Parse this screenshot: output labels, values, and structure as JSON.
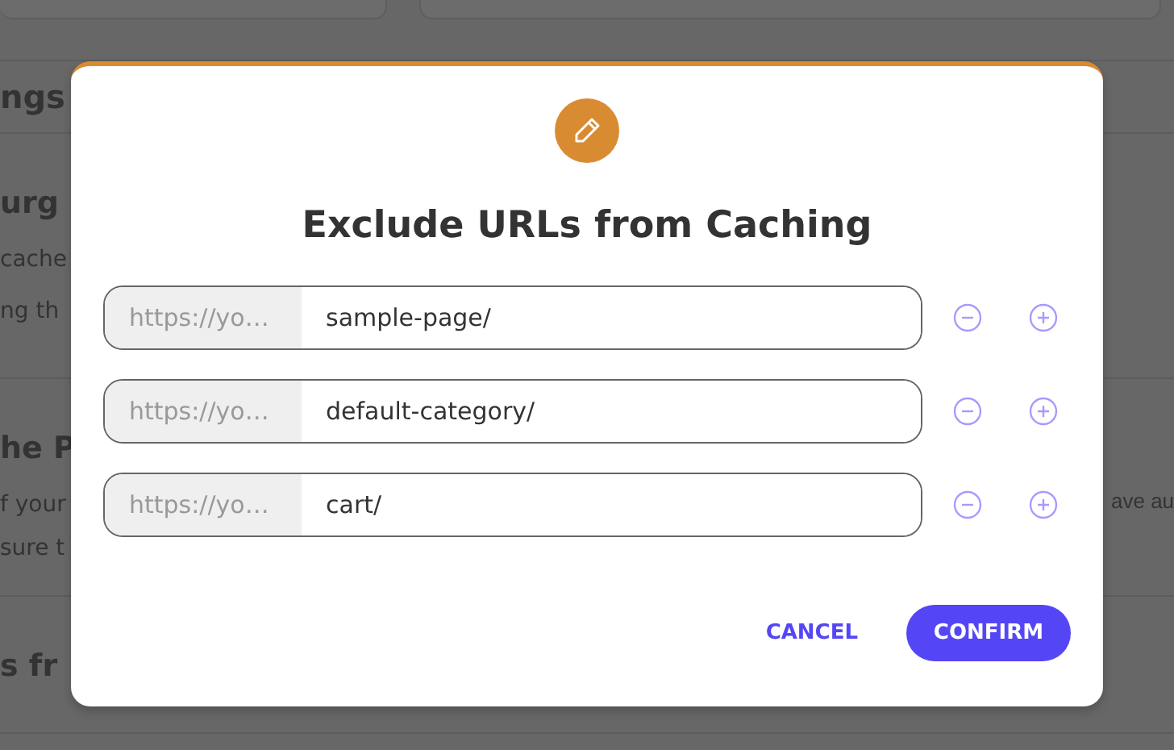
{
  "background": {
    "heading": "ngs",
    "sections": [
      {
        "title": "urg",
        "lines": [
          "cache",
          "ng th"
        ]
      },
      {
        "title": "he P",
        "lines": [
          "f your",
          "sure t"
        ],
        "side_text": "ave au"
      },
      {
        "title": "s fr"
      }
    ]
  },
  "dialog": {
    "title": "Exclude URLs from Caching",
    "rows": [
      {
        "prefix": "https://yo…",
        "value": "sample-page/"
      },
      {
        "prefix": "https://yo…",
        "value": "default-category/"
      },
      {
        "prefix": "https://yo…",
        "value": "cart/"
      }
    ],
    "cancel": "CANCEL",
    "confirm": "CONFIRM"
  }
}
